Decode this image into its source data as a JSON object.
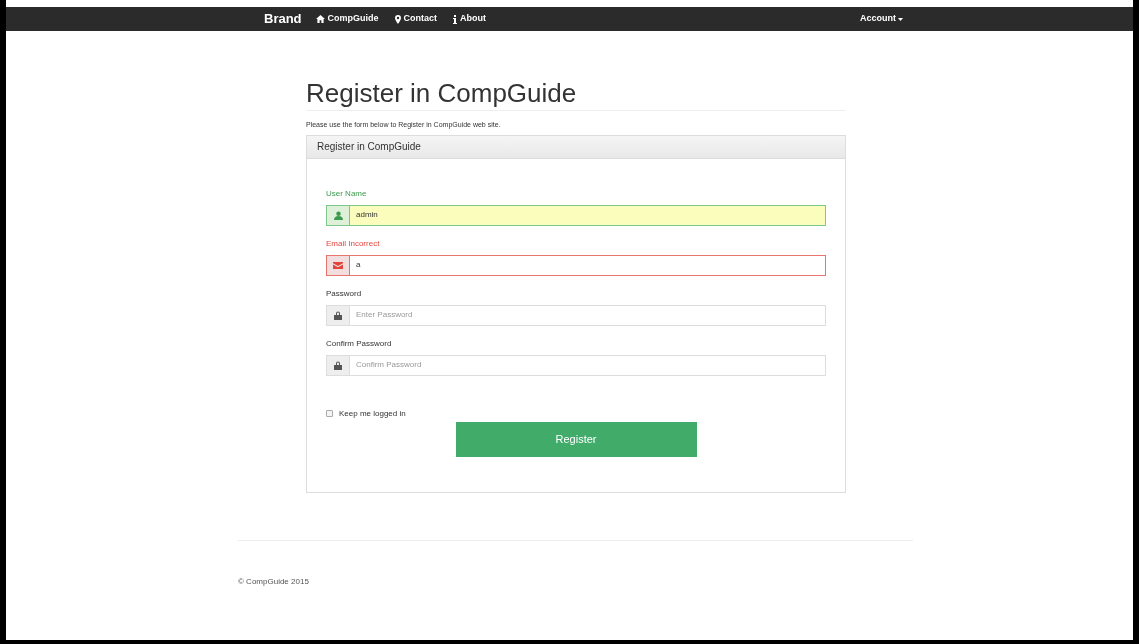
{
  "navbar": {
    "brand": "Brand",
    "links": [
      {
        "label": "CompGuide",
        "kind": "home"
      },
      {
        "label": "Contact",
        "kind": "pin"
      },
      {
        "label": "About",
        "kind": "info"
      }
    ],
    "account": "Account"
  },
  "page": {
    "title": "Register in CompGuide",
    "intro": "Please use the form below to Register in CompGuide web site."
  },
  "panel": {
    "heading": "Register in CompGuide",
    "fields": [
      {
        "label": "User Name",
        "kind": "user",
        "value": "admin",
        "valid": true,
        "invalid": false
      },
      {
        "label": "Email Incorrect",
        "kind": "email",
        "value": "a",
        "valid": false,
        "invalid": true
      },
      {
        "label": "Password",
        "kind": "password",
        "placeholder": "Enter Password",
        "valid": false,
        "invalid": false
      },
      {
        "label": "Confirm Password",
        "kind": "password",
        "placeholder": "Confirm Password",
        "valid": false,
        "invalid": false
      }
    ],
    "remember": {
      "label": "Keep me logged in",
      "checked": false
    },
    "submit": "Register"
  },
  "footer": "© CompGuide 2015"
}
